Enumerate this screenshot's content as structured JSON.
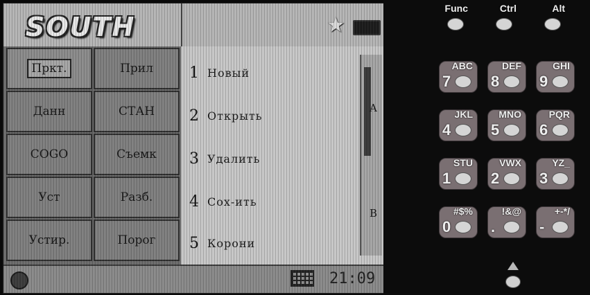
{
  "screen": {
    "brand": "SOUTH",
    "status_icons": {
      "favorite": "star-icon",
      "battery": "battery-icon"
    },
    "menu": [
      {
        "label": "Прκт.",
        "selected": true
      },
      {
        "label": "Прил",
        "selected": false
      },
      {
        "label": "Данн",
        "selected": false
      },
      {
        "label": "СТАН",
        "selected": false
      },
      {
        "label": "COGO",
        "selected": false
      },
      {
        "label": "Съемк",
        "selected": false
      },
      {
        "label": "Уст",
        "selected": false
      },
      {
        "label": "Разб.",
        "selected": false
      },
      {
        "label": "Устир.",
        "selected": false
      },
      {
        "label": "Порог",
        "selected": false
      }
    ],
    "list": [
      {
        "num": "1",
        "label": "Новый"
      },
      {
        "num": "2",
        "label": "Открыть"
      },
      {
        "num": "3",
        "label": "Удалить"
      },
      {
        "num": "4",
        "label": "Сох-ить"
      },
      {
        "num": "5",
        "label": "Корони"
      }
    ],
    "scroll_letters": [
      "A",
      "B"
    ],
    "clock": "21:09"
  },
  "keypad": {
    "top_keys": [
      "Func",
      "Ctrl",
      "Alt"
    ],
    "keys": [
      {
        "label": "ABC",
        "digit": "7"
      },
      {
        "label": "DEF",
        "digit": "8"
      },
      {
        "label": "GHI",
        "digit": "9"
      },
      {
        "label": "JKL",
        "digit": "4"
      },
      {
        "label": "MNO",
        "digit": "5"
      },
      {
        "label": "PQR",
        "digit": "6"
      },
      {
        "label": "STU",
        "digit": "1"
      },
      {
        "label": "VWX",
        "digit": "2"
      },
      {
        "label": "YZ_",
        "digit": "3"
      },
      {
        "label": "#$%",
        "digit": "0"
      },
      {
        "label": "!&@",
        "digit": "."
      },
      {
        "label": "+-*/",
        "digit": "-"
      }
    ]
  }
}
